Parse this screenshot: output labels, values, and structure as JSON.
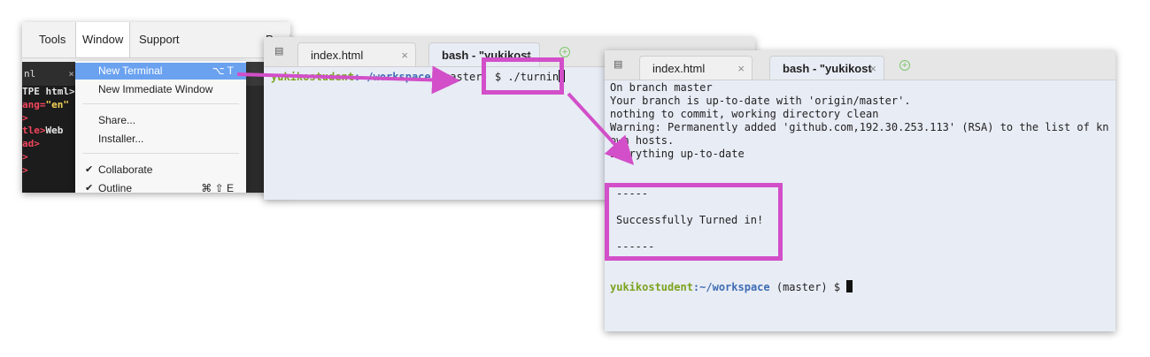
{
  "menu_panel": {
    "menubar": [
      "Tools",
      "Window",
      "Support",
      "Previ"
    ],
    "editor_tab": "nl",
    "editor_lines": [
      {
        "a": "TPE html>",
        "b": ""
      },
      {
        "a": "ang=",
        "b": "\"en\""
      },
      {
        "a": ">",
        "b": ""
      },
      {
        "a": "tle>",
        "b": "Web"
      },
      {
        "a": "ad>",
        "b": ""
      },
      {
        "a": ">",
        "b": ""
      },
      {
        "a": ">",
        "b": ""
      }
    ],
    "window_menu": [
      {
        "label": "New Terminal",
        "shortcut": "⌥ T"
      },
      {
        "label": "New Immediate Window",
        "shortcut": ""
      },
      {
        "label": "Share...",
        "shortcut": ""
      },
      {
        "label": "Installer...",
        "shortcut": ""
      },
      {
        "label": "Collaborate",
        "shortcut": ""
      },
      {
        "label": "Outline",
        "shortcut": "⌘ ⇧ E"
      }
    ]
  },
  "terminal_small": {
    "tabs": [
      "index.html",
      "bash - \"yukikost"
    ],
    "prompt_user": "yukikostudent",
    "prompt_path": ":~/workspace",
    "prompt_branch": " (master)",
    "command": " $ ./turnin"
  },
  "terminal_large": {
    "tabs": [
      "index.html",
      "bash - \"yukikost"
    ],
    "output": [
      "On branch master",
      "Your branch is up-to-date with 'origin/master'.",
      "nothing to commit, working directory clean",
      "Warning: Permanently added 'github.com,192.30.253.113' (RSA) to the list of kn",
      "own hosts.",
      "Everything up-to-date",
      "",
      "",
      "-----",
      "",
      "Successfully Turned in!",
      "",
      "------"
    ],
    "prompt_user": "yukikostudent",
    "prompt_path": ":~/workspace",
    "prompt_rest": " (master) $ "
  },
  "colors": {
    "annotation": "#d24fc9",
    "menu_highlight": "#6aa2f0",
    "prompt_user": "#7ba31f",
    "prompt_path": "#3f6db3",
    "terminal_bg": "#e8ecf5"
  }
}
